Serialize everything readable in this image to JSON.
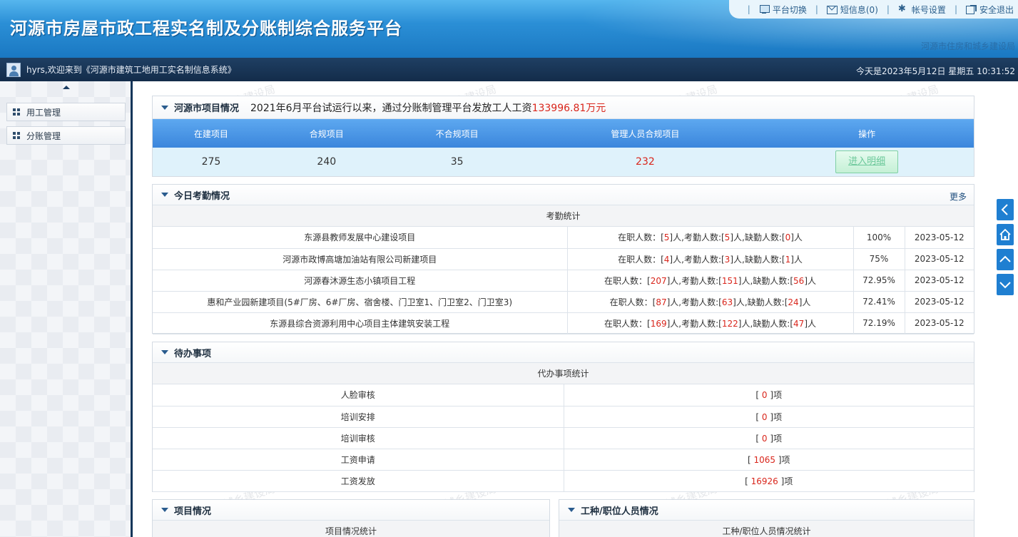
{
  "header": {
    "title": "河源市房屋市政工程实名制及分账制综合服务平台",
    "subtitle": "河源市住房和城乡建设局",
    "nav": [
      {
        "label": "平台切换",
        "icon": "platform-switch-icon"
      },
      {
        "label": "短信息(0)",
        "icon": "mail-icon"
      },
      {
        "label": "帐号设置",
        "icon": "gear-icon"
      },
      {
        "label": "安全退出",
        "icon": "exit-icon"
      }
    ]
  },
  "infobar": {
    "welcome": "hyrs,欢迎来到《河源市建筑工地用工实名制信息系统》",
    "datetime": "今天是2023年5月12日 星期五 10:31:52"
  },
  "sidebar": {
    "items": [
      {
        "label": "用工管理"
      },
      {
        "label": "分账管理"
      }
    ]
  },
  "watermark": "河源市住房和城乡建设局",
  "project_overview": {
    "title": "河源市项目情况",
    "summary_prefix": "2021年6月平台试运行以来，通过分账制管理平台发放工人工资",
    "summary_amount": "133996.81万元",
    "headers": [
      "在建项目",
      "合规项目",
      "不合规项目",
      "管理人员合规项目",
      "操作"
    ],
    "values": [
      "275",
      "240",
      "35",
      "232"
    ],
    "action_label": "进入明细"
  },
  "attendance": {
    "title": "今日考勤情况",
    "more_label": "更多",
    "sub_title": "考勤统计",
    "rows": [
      {
        "project": "东源县教师发展中心建设项目",
        "employed": "5",
        "present": "5",
        "absent": "0",
        "rate": "100%",
        "date": "2023-05-12"
      },
      {
        "project": "河源市政博高塘加油站有限公司新建项目",
        "employed": "4",
        "present": "3",
        "absent": "1",
        "rate": "75%",
        "date": "2023-05-12"
      },
      {
        "project": "河源春沐源生态小镇项目工程",
        "employed": "207",
        "present": "151",
        "absent": "56",
        "rate": "72.95%",
        "date": "2023-05-12"
      },
      {
        "project": "惠和产业园新建项目(5#厂房、6#厂房、宿舍楼、门卫室1、门卫室2、门卫室3)",
        "employed": "87",
        "present": "63",
        "absent": "24",
        "rate": "72.41%",
        "date": "2023-05-12"
      },
      {
        "project": "东源县综合资源利用中心项目主体建筑安装工程",
        "employed": "169",
        "present": "122",
        "absent": "47",
        "rate": "72.19%",
        "date": "2023-05-12"
      }
    ],
    "labels": {
      "employed": "在职人数：",
      "present": "考勤人数:",
      "absent": "缺勤人数:",
      "unit": "人"
    }
  },
  "todo": {
    "title": "待办事项",
    "sub_title": "代办事项统计",
    "unit": "项",
    "rows": [
      {
        "label": "人脸审核",
        "count": "0"
      },
      {
        "label": "培训安排",
        "count": "0"
      },
      {
        "label": "培训审核",
        "count": "0"
      },
      {
        "label": "工资申请",
        "count": "1065"
      },
      {
        "label": "工资发放",
        "count": "16926"
      }
    ]
  },
  "project_info": {
    "title": "项目情况",
    "sub_title": "项目情况统计"
  },
  "trade_info": {
    "title": "工种/职位人员情况",
    "sub_title": "工种/职位人员情况统计"
  },
  "tools": [
    {
      "icon": "chevron-left-icon"
    },
    {
      "icon": "home-icon"
    },
    {
      "icon": "chevron-up-icon"
    },
    {
      "icon": "chevron-down-icon"
    }
  ],
  "colors": {
    "header_blue": "#2b8fd6",
    "infobar_dark": "#132c4a",
    "accent_red": "#d9261c",
    "table_head_blue": "#3b86dc",
    "tool_blue": "#1f7fd1"
  }
}
